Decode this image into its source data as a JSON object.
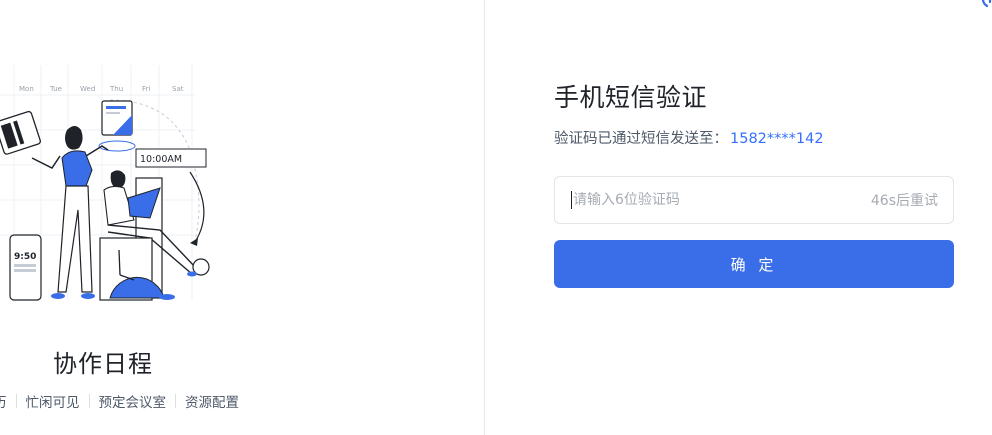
{
  "illustration": {
    "weekdays": [
      "Mon",
      "Tue",
      "Wed",
      "Thu",
      "Fri",
      "Sat"
    ],
    "time_card": "10:00AM",
    "phone_time": "9:50"
  },
  "feature": {
    "title": "协作日程",
    "tags": [
      "历",
      "忙闲可见",
      "预定会议室",
      "资源配置"
    ]
  },
  "verify": {
    "title": "手机短信验证",
    "desc": "验证码已通过短信发送至：",
    "phone": "1582****142",
    "placeholder": "请输入6位验证码",
    "resend": "46s后重试",
    "confirm": "确 定"
  },
  "colors": {
    "accent": "#3a6ee8",
    "link": "#3370ff"
  }
}
